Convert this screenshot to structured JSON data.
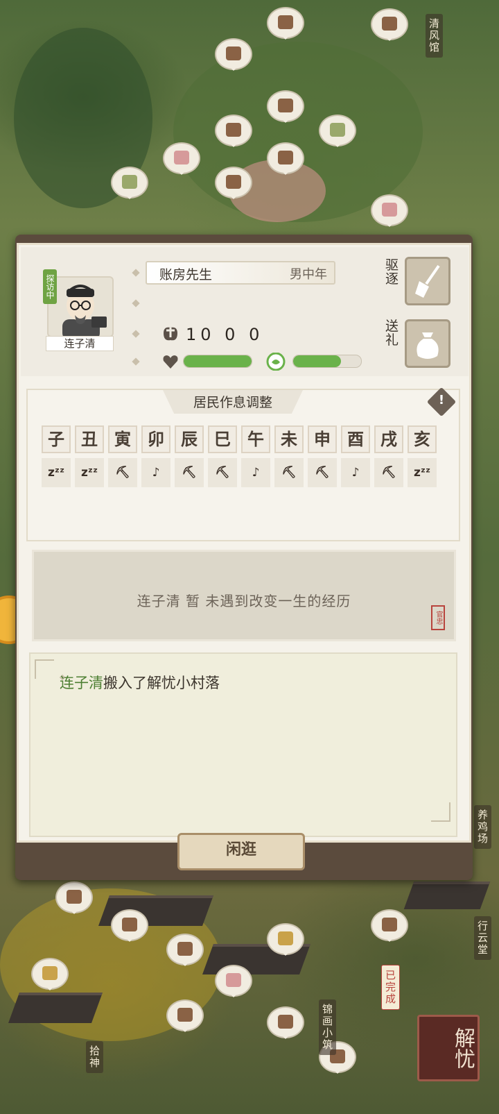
{
  "resident": {
    "name": "连子清",
    "visiting_tag": "探访中",
    "occupation": "账房先生",
    "gender_age": "男中年",
    "money": "10 0 0",
    "health_pct": 100,
    "mood_pct": 70,
    "expel_label": "驱逐",
    "gift_label": "送礼"
  },
  "schedule": {
    "title": "居民作息调整",
    "warn_glyph": "!",
    "hours": [
      "子",
      "丑",
      "寅",
      "卯",
      "辰",
      "巳",
      "午",
      "未",
      "申",
      "酉",
      "戌",
      "亥"
    ],
    "activities": [
      "sleep",
      "sleep",
      "work",
      "leisure",
      "work",
      "work",
      "leisure",
      "work",
      "work",
      "leisure",
      "work",
      "sleep"
    ],
    "activity_glyphs": {
      "sleep": "zᶻᶻ",
      "work": "⛏",
      "leisure": "♪"
    }
  },
  "story": {
    "text": "连子清 暂 未遇到改变一生的经历",
    "stamp": "官忠"
  },
  "log": {
    "name": "连子清",
    "text": "搬入了解忧小村落"
  },
  "background": {
    "button": "闲逛",
    "town_badge": "解忧",
    "labels": [
      "清风馆",
      "养鸡场",
      "行云堂",
      "锦画小筑",
      "拾神",
      "已完成"
    ]
  }
}
